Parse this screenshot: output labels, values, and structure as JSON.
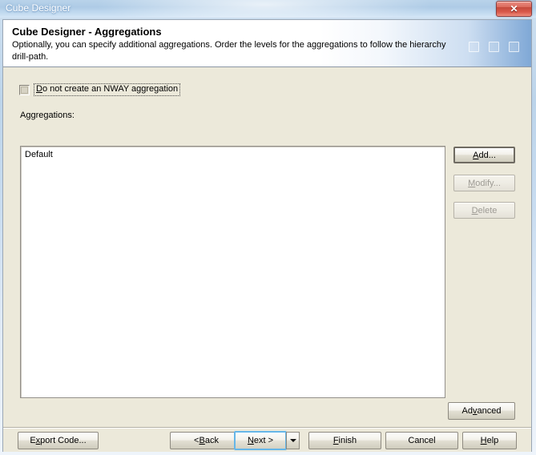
{
  "window": {
    "title": "Cube Designer",
    "close_label": "✕"
  },
  "header": {
    "title": "Cube Designer - Aggregations",
    "description": "Optionally, you can specify additional aggregations. Order the levels for the aggregations to follow the hierarchy drill-path."
  },
  "options": {
    "nway": {
      "label_pre": "D",
      "label_post": "o not create an NWAY aggregation",
      "checked": false
    }
  },
  "aggregations": {
    "label": "Aggregations:",
    "items": [
      {
        "name": "Default"
      }
    ]
  },
  "side_buttons": {
    "add": {
      "pre": "A",
      "post": "dd...",
      "enabled": true
    },
    "modify": {
      "pre": "M",
      "post": "odify...",
      "enabled": false
    },
    "delete": {
      "pre": "D",
      "post": "elete",
      "enabled": false
    },
    "advanced": {
      "pre": "Ad",
      "mn": "v",
      "post": "anced",
      "enabled": true
    }
  },
  "footer_buttons": {
    "export_code": {
      "pre": "E",
      "mn": "x",
      "post": "port Code..."
    },
    "back": {
      "pre": "< ",
      "mn": "B",
      "post": "ack"
    },
    "next": {
      "mn": "N",
      "post": "ext >"
    },
    "next_dropdown": {
      "icon": "chevron-down-icon"
    },
    "finish": {
      "mn": "F",
      "post": "inish"
    },
    "cancel": {
      "label": "Cancel"
    },
    "help": {
      "mn": "H",
      "post": "elp"
    }
  },
  "colors": {
    "dialog_background": "#ece9da",
    "titlebar_blue": "#b9d3ea",
    "close_red": "#c44a3c",
    "focus_blue": "#65b6e8",
    "list_background": "#ffffff"
  }
}
